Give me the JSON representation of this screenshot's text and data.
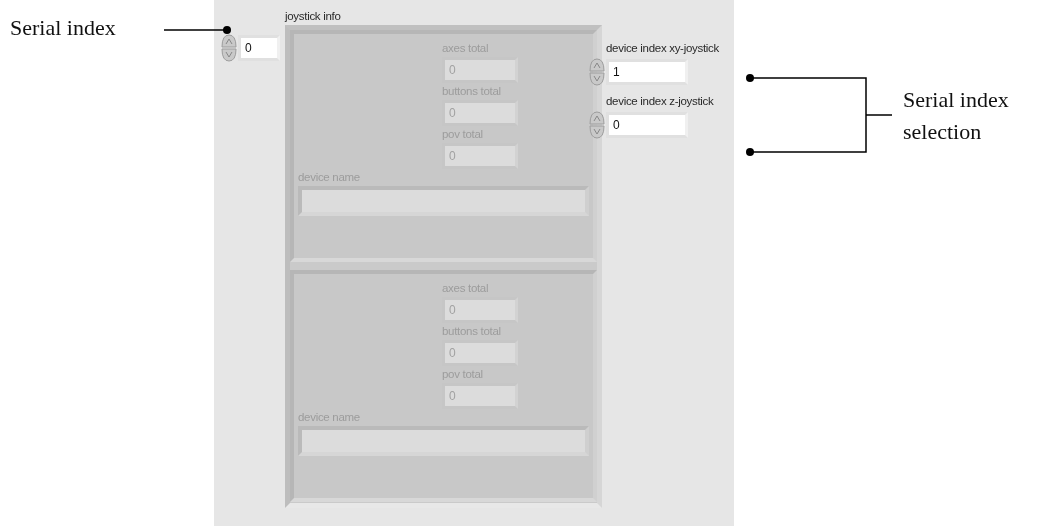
{
  "serial_index": {
    "value": "0"
  },
  "joystick_info": {
    "label": "joystick info",
    "disabled": true,
    "elements": [
      {
        "counters": [
          {
            "label": "axes total",
            "value": "0"
          },
          {
            "label": "buttons total",
            "value": "0"
          },
          {
            "label": "pov total",
            "value": "0"
          }
        ],
        "device_name": {
          "label": "device name"
        }
      },
      {
        "counters": [
          {
            "label": "axes total",
            "value": "0"
          },
          {
            "label": "buttons total",
            "value": "0"
          },
          {
            "label": "pov total",
            "value": "0"
          }
        ],
        "device_name": {
          "label": "device name"
        }
      }
    ]
  },
  "device_indices": [
    {
      "label": "device index xy-joystick",
      "value": "1"
    },
    {
      "label": "device index z-joystick",
      "value": "0"
    }
  ],
  "annotations": [
    {
      "text": "Serial index"
    },
    {
      "text": "Serial index selection"
    }
  ]
}
